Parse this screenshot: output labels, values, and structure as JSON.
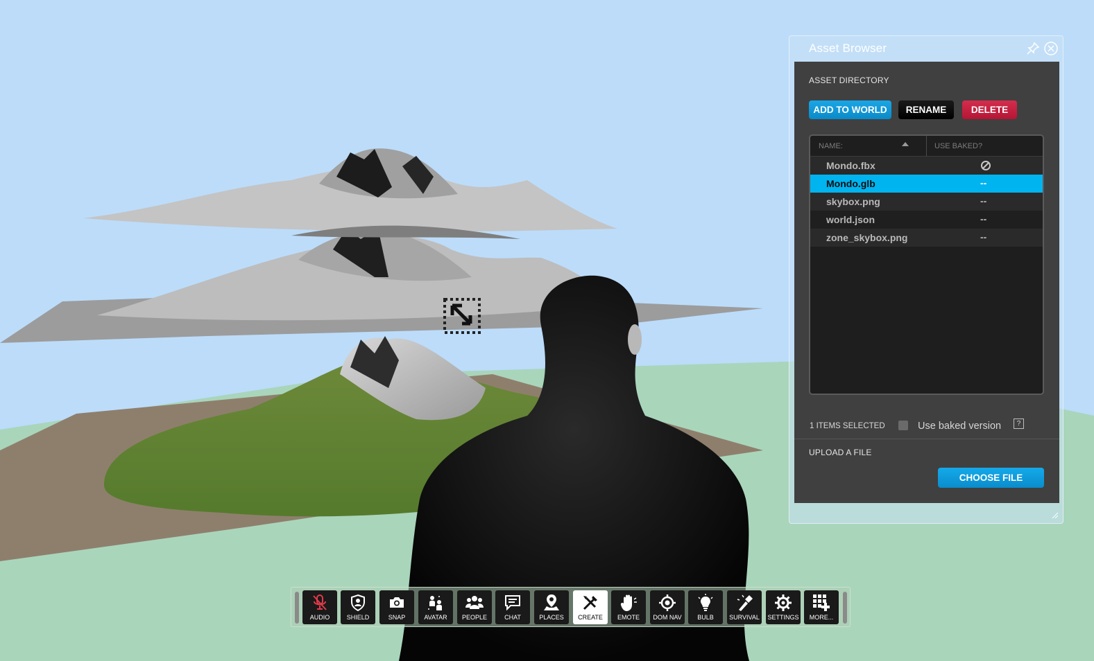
{
  "window": {
    "title": "Asset Browser",
    "icons": {
      "pin": "pin-icon",
      "close": "close-icon"
    }
  },
  "asset_directory": {
    "label": "ASSET DIRECTORY",
    "buttons": {
      "add": "ADD TO WORLD",
      "rename": "RENAME",
      "delete": "DELETE"
    },
    "columns": {
      "name": "NAME:",
      "baked": "USE BAKED?"
    },
    "rows": [
      {
        "name": "Mondo.fbx",
        "baked": ""
      },
      {
        "name": "Mondo.glb",
        "baked": "--"
      },
      {
        "name": "skybox.png",
        "baked": "--"
      },
      {
        "name": "world.json",
        "baked": "--"
      },
      {
        "name": "zone_skybox.png",
        "baked": "--"
      }
    ],
    "selected_count": "1 ITEMS SELECTED",
    "use_baked_label": "Use baked version",
    "help": "?"
  },
  "upload": {
    "label": "UPLOAD A FILE",
    "button": "CHOOSE FILE"
  },
  "toolbar": {
    "items": [
      {
        "label": "AUDIO",
        "icon": "muted-mic-icon"
      },
      {
        "label": "SHIELD",
        "icon": "shield-icon"
      },
      {
        "label": "SNAP",
        "icon": "camera-icon"
      },
      {
        "label": "AVATAR",
        "icon": "avatar-icon"
      },
      {
        "label": "PEOPLE",
        "icon": "people-icon"
      },
      {
        "label": "CHAT",
        "icon": "chat-icon"
      },
      {
        "label": "PLACES",
        "icon": "places-icon"
      },
      {
        "label": "CREATE",
        "icon": "create-tools-icon"
      },
      {
        "label": "EMOTE",
        "icon": "hand-icon"
      },
      {
        "label": "DOM NAV",
        "icon": "target-icon"
      },
      {
        "label": "BULB",
        "icon": "bulb-icon"
      },
      {
        "label": "SURVIVAL",
        "icon": "flashlight-icon"
      },
      {
        "label": "SETTINGS",
        "icon": "gear-icon"
      },
      {
        "label": "MORE...",
        "icon": "more-apps-icon"
      }
    ]
  },
  "colors": {
    "sky": "#bcdcfa",
    "accent_blue": "#00b4ef",
    "delete_red": "#c81e3e",
    "ground_green": "#a8d4b8"
  }
}
